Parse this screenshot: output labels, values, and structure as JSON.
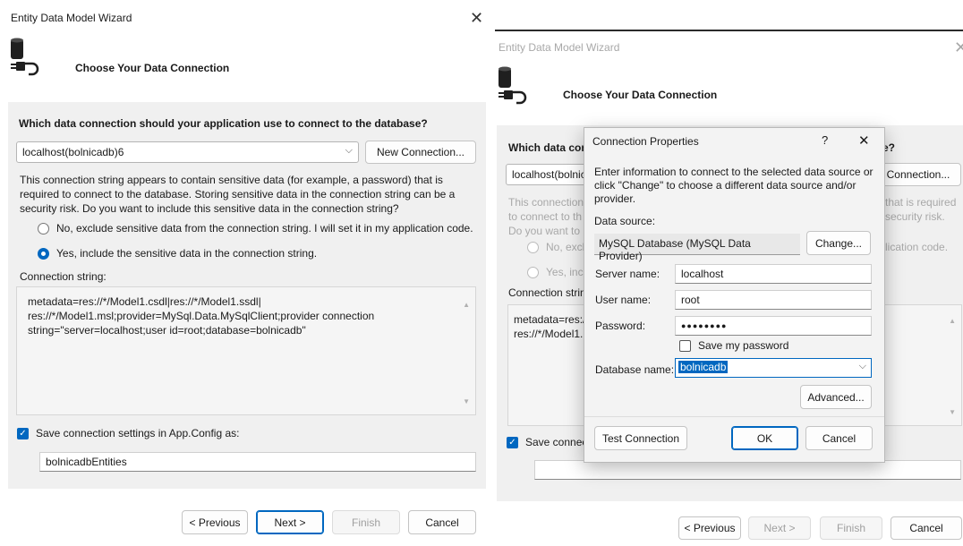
{
  "left": {
    "window_title": "Entity Data Model Wizard",
    "header_title": "Choose Your Data Connection",
    "question": "Which data connection should your application use to connect to the database?",
    "connection_value": "localhost(bolnicadb)6",
    "new_connection_label": "New Connection...",
    "warning_text": "This connection string appears to contain sensitive data (for example, a password) that is required to connect to the database. Storing sensitive data in the connection string can be a security risk. Do you want to include this sensitive data in the connection string?",
    "radio_no_label": "No, exclude sensitive data from the connection string. I will set it in my application code.",
    "radio_yes_label": "Yes, include the sensitive data in the connection string.",
    "conn_string_label": "Connection string:",
    "conn_string_value": "metadata=res://*/Model1.csdl|res://*/Model1.ssdl|\nres://*/Model1.msl;provider=MySql.Data.MySqlClient;provider connection\nstring=\"server=localhost;user id=root;database=bolnicadb\"",
    "save_settings_label": "Save connection settings in App.Config as:",
    "entities_name": "bolnicadbEntities",
    "buttons": {
      "previous": "< Previous",
      "next": "Next >",
      "finish": "Finish",
      "cancel": "Cancel"
    }
  },
  "right": {
    "window_title": "Entity Data Model Wizard",
    "header_title": "Choose Your Data Connection",
    "question_partial": "Which data con",
    "question_tail": "e?",
    "connection_partial": "localhost(bolnic",
    "new_connection_partial": "Connection...",
    "warn_lines_left": [
      "This connection",
      "to connect to th",
      "Do you want to"
    ],
    "warn_lines_right": [
      "that is required",
      "security risk."
    ],
    "radio_no_partial": "No, exclu",
    "radio_no_tail": "lication code.",
    "radio_yes_partial": "Yes, inclu",
    "conn_string_label_partial": "Connection strin",
    "conn_lines": [
      "metadata=res://,",
      "res://*/Model1.r"
    ],
    "save_partial": "Save connecti",
    "buttons": {
      "previous": "< Previous",
      "next": "Next >",
      "finish": "Finish",
      "cancel": "Cancel"
    }
  },
  "dialog": {
    "title": "Connection Properties",
    "help": "?",
    "close": "✕",
    "intro": "Enter information to connect to the selected data source or click \"Change\" to choose a different data source and/or provider.",
    "data_source_label": "Data source:",
    "data_source_value": "MySQL Database (MySQL Data Provider)",
    "change_label": "Change...",
    "server_label": "Server name:",
    "server_value": "localhost",
    "user_label": "User name:",
    "user_value": "root",
    "password_label": "Password:",
    "password_value": "●●●●●●●●",
    "save_password_label": "Save my password",
    "database_label": "Database name:",
    "database_value": "bolnicadb",
    "advanced_label": "Advanced...",
    "test_label": "Test Connection",
    "ok_label": "OK",
    "cancel_label": "Cancel"
  },
  "colors": {
    "accent": "#0067c0",
    "panel": "#f0f0f0"
  }
}
